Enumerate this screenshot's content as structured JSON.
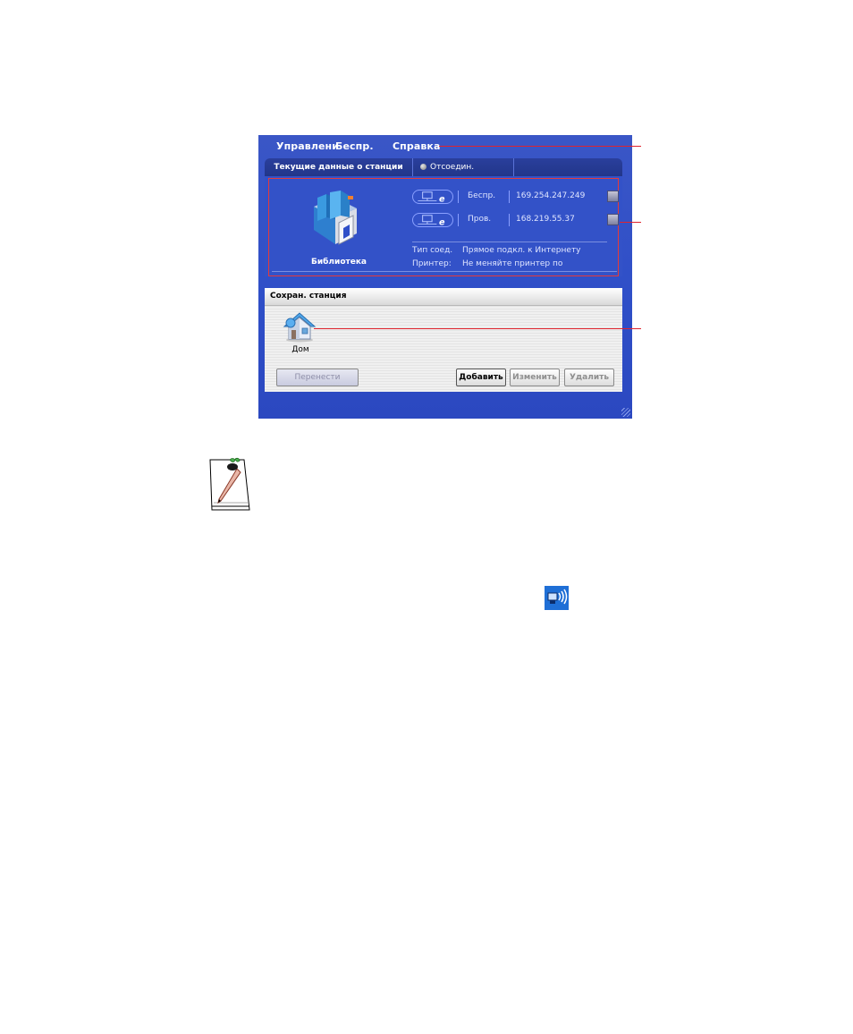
{
  "menu": {
    "items": [
      "Управлени",
      "Беспр.",
      "Справка"
    ]
  },
  "tabs": {
    "current_label": "Текущие данные о станции",
    "status_label": "Отсоедин."
  },
  "station": {
    "name": "Библиотека",
    "connections": [
      {
        "type": "Беспр.",
        "ip": "169.254.247.249"
      },
      {
        "type": "Пров.",
        "ip": "168.219.55.37"
      }
    ],
    "connection_type_label": "Тип соед.",
    "connection_type_value": "Прямое подкл. к Интернету",
    "printer_label": "Принтер:",
    "printer_value": "Не меняйте принтер по"
  },
  "saved": {
    "title": "Сохран. станция",
    "items": [
      {
        "label": "Дом"
      }
    ]
  },
  "buttons": {
    "move": "Перенести",
    "add": "Добавить",
    "edit": "Изменить",
    "delete": "Удалить"
  },
  "colors": {
    "window_blue": "#2f4fc8",
    "callout_red": "#e0232d",
    "highlight_red": "#e63a3a"
  },
  "icons": {
    "station": "library-books-icon",
    "home": "home-icon",
    "note": "note-pencil-icon",
    "tray": "wireless-tray-icon"
  }
}
